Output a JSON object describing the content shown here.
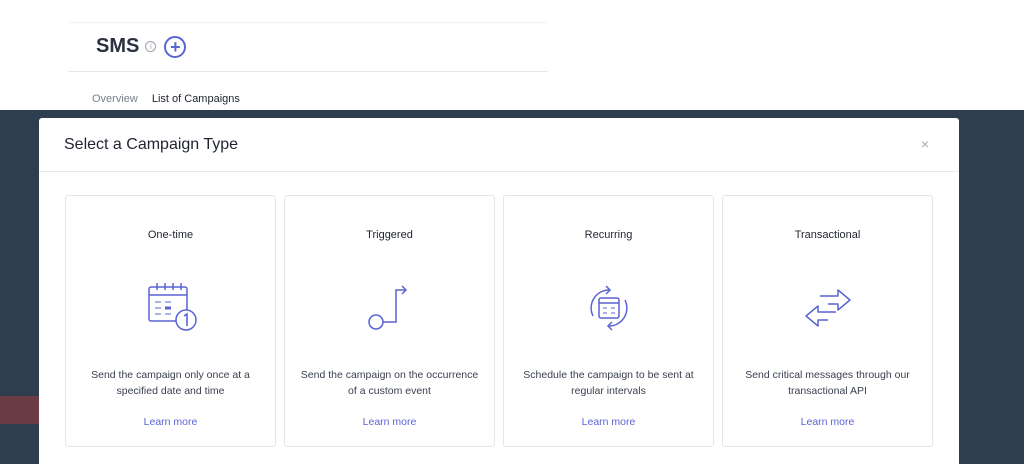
{
  "page": {
    "title": "SMS",
    "info_glyph": "i",
    "add_glyph": "+",
    "tabs": [
      {
        "label": "Overview"
      },
      {
        "label": "List of Campaigns"
      }
    ]
  },
  "modal": {
    "title": "Select a Campaign Type",
    "close_glyph": "×",
    "cards": [
      {
        "title": "One-time",
        "icon": "calendar-icon",
        "description": "Send the campaign only once at a specified date and time",
        "link": "Learn more"
      },
      {
        "title": "Triggered",
        "icon": "trigger-arrow-icon",
        "description": "Send the campaign on the occurrence of a custom event",
        "link": "Learn more"
      },
      {
        "title": "Recurring",
        "icon": "recurring-calendar-icon",
        "description": "Schedule the campaign to be sent at regular intervals",
        "link": "Learn more"
      },
      {
        "title": "Transactional",
        "icon": "exchange-arrows-icon",
        "description": "Send critical messages through our transactional API",
        "link": "Learn more"
      }
    ]
  },
  "colors": {
    "accent": "#5a64d4",
    "overlay": "#2f3e4f"
  }
}
